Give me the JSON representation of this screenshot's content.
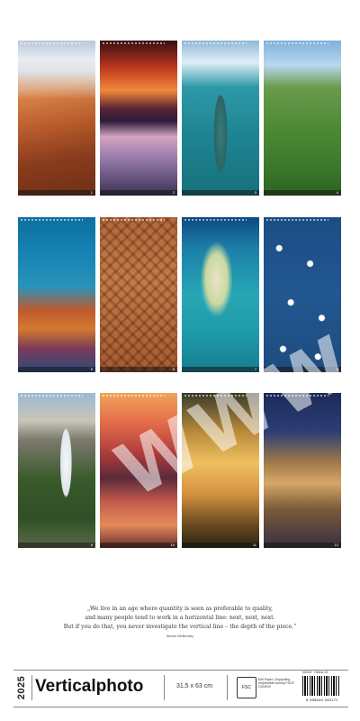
{
  "calendar": {
    "year": "2025",
    "title": "Verticalphoto",
    "size": "31,5 x 63 cm"
  },
  "photos": [
    {
      "subject": "canyon-hoodoos-snow",
      "page": "1"
    },
    {
      "subject": "sunset-lake-ice",
      "page": "2"
    },
    {
      "subject": "shipwreck-glacier-bay",
      "page": "3"
    },
    {
      "subject": "terraced-gardens-temple",
      "page": "4"
    },
    {
      "subject": "sea-turtle-reef",
      "page": "5"
    },
    {
      "subject": "city-grid-aerial",
      "page": "6"
    },
    {
      "subject": "tropical-island-resort",
      "page": "7"
    },
    {
      "subject": "sailboat-regatta",
      "page": "8"
    },
    {
      "subject": "mountain-waterfall",
      "page": "9"
    },
    {
      "subject": "pagoda-reflection",
      "page": "10"
    },
    {
      "subject": "karst-river-sunset",
      "page": "11"
    },
    {
      "subject": "cathedral-square-night",
      "page": "12"
    }
  ],
  "watermark": "WWW",
  "quote": {
    "line1": "„We live in an age where quantity is seen as preferable to quality,",
    "line2": "and many people tend to work in a horizontal line: next, next, next.",
    "line3": "But if you do that, you never investigate the vertical line – the depth of the piece.“",
    "author": "Simon McBurney"
  },
  "footer": {
    "fsc_label": "FSC",
    "fsc_text": "MIX Paper | Supporting responsible forestry FSC® C004919",
    "product_code": "N2615",
    "publisher": "Helma 24",
    "barcode_number": "8 596640 050171"
  },
  "colors": {
    "text": "#222222",
    "rule": "#888888",
    "background": "#ffffff"
  }
}
